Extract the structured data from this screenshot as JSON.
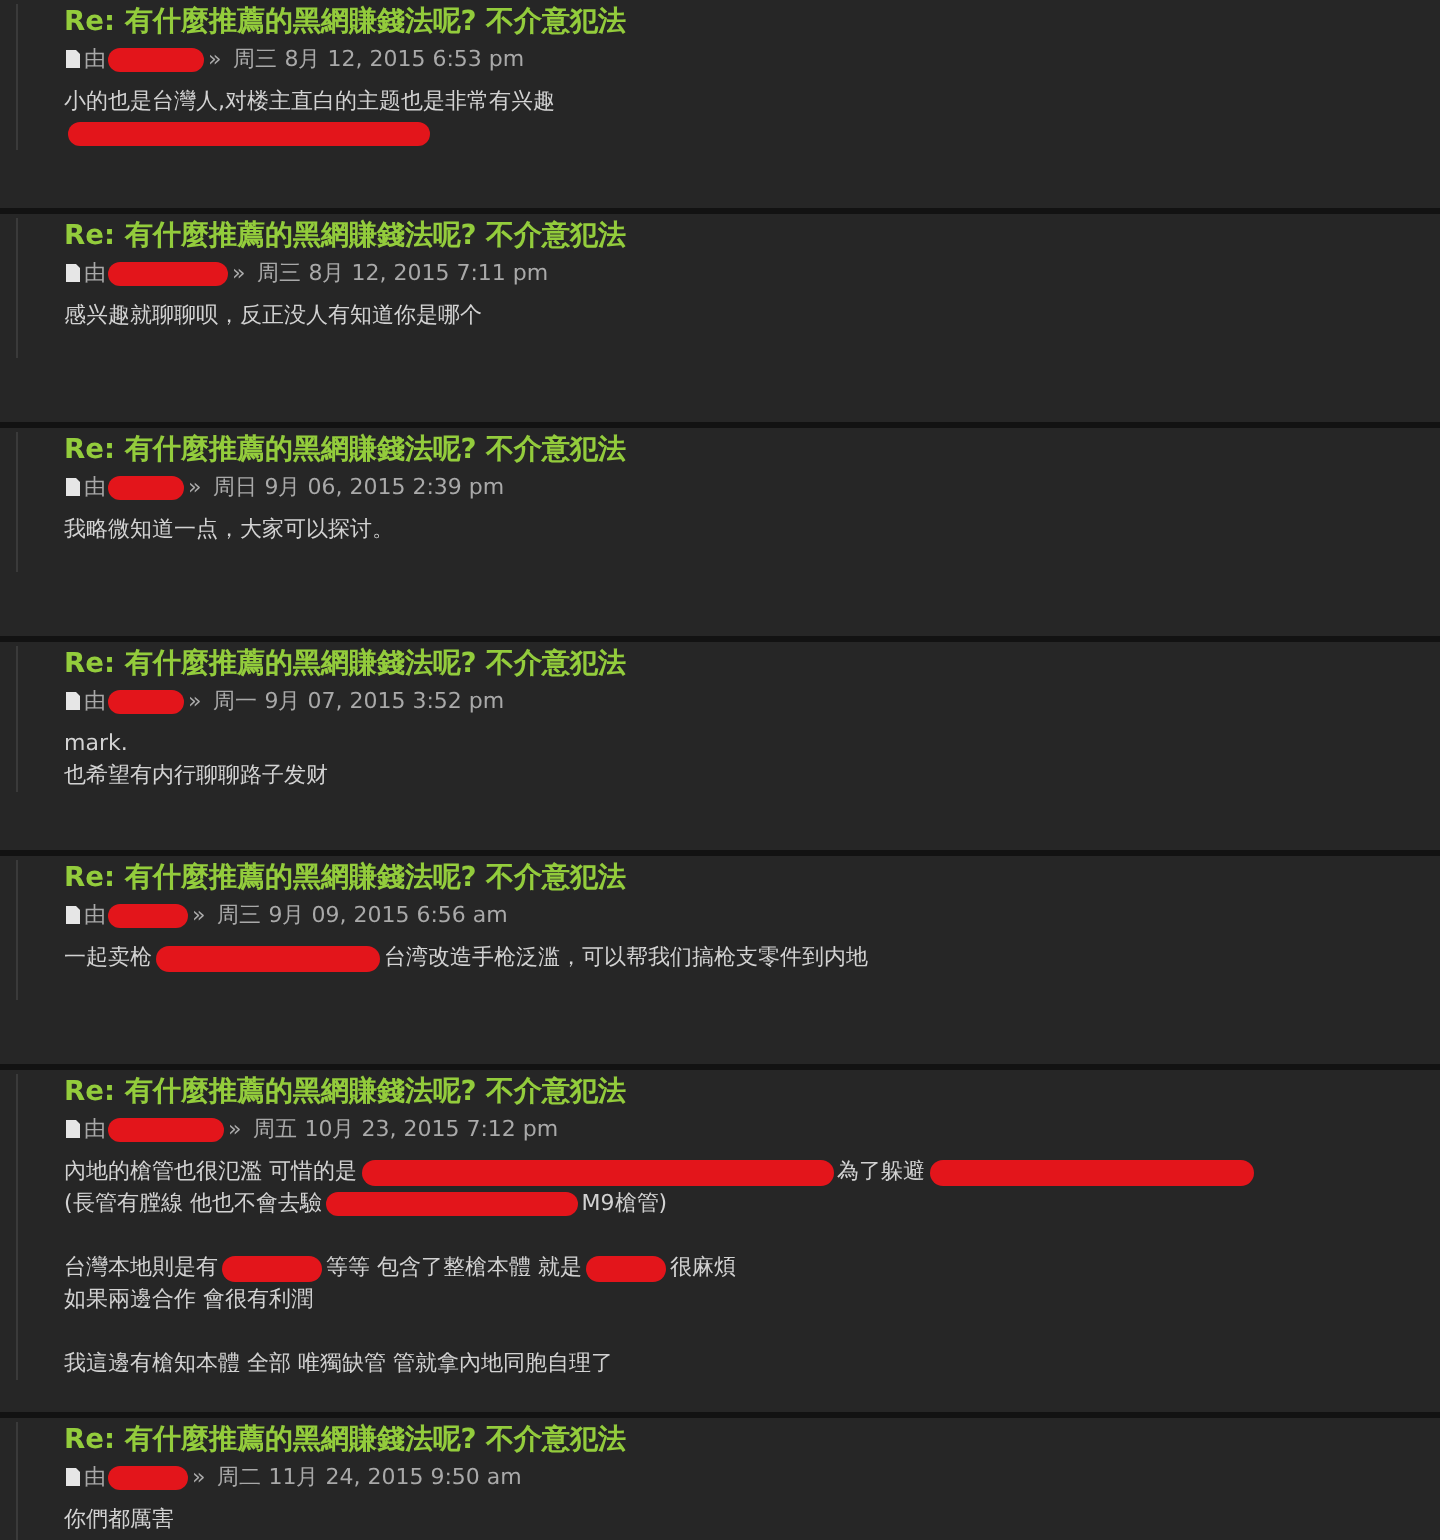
{
  "posts": [
    {
      "title": "Re: 有什麼推薦的黑網賺錢法呢? 不介意犯法",
      "byline": [
        {
          "kind": "label",
          "text": "由"
        },
        {
          "kind": "redaction"
        },
        {
          "kind": "separator",
          "text": "»"
        },
        {
          "kind": "date",
          "text": "周三 8月 12, 2015 6:53 pm"
        }
      ],
      "body": [
        [
          [
            {
              "kind": "text",
              "text": "小的也是台灣人,对楼主直白的主题也是非常有兴趣"
            }
          ],
          [
            {
              "kind": "redaction"
            }
          ]
        ]
      ]
    },
    {
      "title": "Re: 有什麼推薦的黑網賺錢法呢? 不介意犯法",
      "byline": [
        {
          "kind": "label",
          "text": "由"
        },
        {
          "kind": "redaction"
        },
        {
          "kind": "separator",
          "text": "»"
        },
        {
          "kind": "date",
          "text": "周三 8月 12, 2015 7:11 pm"
        }
      ],
      "body": [
        [
          [
            {
              "kind": "text",
              "text": "感兴趣就聊聊呗，反正没人有知道你是哪个"
            }
          ]
        ]
      ]
    },
    {
      "title": "Re: 有什麼推薦的黑網賺錢法呢? 不介意犯法",
      "byline": [
        {
          "kind": "label",
          "text": "由"
        },
        {
          "kind": "redaction"
        },
        {
          "kind": "separator",
          "text": "»"
        },
        {
          "kind": "date",
          "text": "周日 9月 06, 2015 2:39 pm"
        }
      ],
      "body": [
        [
          [
            {
              "kind": "text",
              "text": "我略微知道一点，大家可以探讨。"
            }
          ]
        ]
      ]
    },
    {
      "title": "Re: 有什麼推薦的黑網賺錢法呢? 不介意犯法",
      "byline": [
        {
          "kind": "label",
          "text": "由"
        },
        {
          "kind": "redaction"
        },
        {
          "kind": "separator",
          "text": "»"
        },
        {
          "kind": "date",
          "text": "周一 9月 07, 2015 3:52 pm"
        }
      ],
      "body": [
        [
          [
            {
              "kind": "text",
              "text": "mark."
            }
          ],
          [
            {
              "kind": "text",
              "text": "也希望有内行聊聊路子发财"
            }
          ]
        ]
      ]
    },
    {
      "title": "Re: 有什麼推薦的黑網賺錢法呢? 不介意犯法",
      "byline": [
        {
          "kind": "label",
          "text": "由"
        },
        {
          "kind": "redaction"
        },
        {
          "kind": "separator",
          "text": "»"
        },
        {
          "kind": "date",
          "text": "周三 9月 09, 2015 6:56 am"
        }
      ],
      "body": [
        [
          [
            {
              "kind": "text",
              "text": "一起卖枪"
            },
            {
              "kind": "redaction"
            },
            {
              "kind": "text",
              "text": "台湾改造手枪泛滥，可以帮我们搞枪支零件到内地"
            }
          ]
        ]
      ]
    },
    {
      "title": "Re: 有什麼推薦的黑網賺錢法呢? 不介意犯法",
      "byline": [
        {
          "kind": "label",
          "text": "由"
        },
        {
          "kind": "redaction"
        },
        {
          "kind": "separator",
          "text": "»"
        },
        {
          "kind": "date",
          "text": "周五 10月 23, 2015 7:12 pm"
        }
      ],
      "body": [
        [
          [
            {
              "kind": "text",
              "text": "內地的槍管也很氾濫 可惜的是"
            },
            {
              "kind": "redaction"
            },
            {
              "kind": "text",
              "text": "為了躲避"
            },
            {
              "kind": "redaction"
            }
          ],
          [
            {
              "kind": "text",
              "text": "(長管有膛線 他也不會去驗"
            },
            {
              "kind": "redaction"
            },
            {
              "kind": "text",
              "text": "M9槍管)"
            }
          ]
        ],
        [
          [
            {
              "kind": "text",
              "text": "台灣本地則是有"
            },
            {
              "kind": "redaction"
            },
            {
              "kind": "text",
              "text": "等等 包含了整槍本體 就是"
            },
            {
              "kind": "redaction"
            },
            {
              "kind": "text",
              "text": "很麻煩"
            }
          ],
          [
            {
              "kind": "text",
              "text": "如果兩邊合作 會很有利潤"
            }
          ]
        ],
        [
          [
            {
              "kind": "text",
              "text": "我這邊有槍知本體 全部 唯獨缺管 管就拿內地同胞自理了"
            }
          ]
        ]
      ]
    },
    {
      "title": "Re: 有什麼推薦的黑網賺錢法呢? 不介意犯法",
      "byline": [
        {
          "kind": "label",
          "text": "由"
        },
        {
          "kind": "redaction"
        },
        {
          "kind": "separator",
          "text": "»"
        },
        {
          "kind": "date",
          "text": "周二 11月 24, 2015 9:50 am"
        }
      ],
      "body": [
        [
          [
            {
              "kind": "text",
              "text": "你們都厲害"
            }
          ]
        ]
      ]
    }
  ]
}
